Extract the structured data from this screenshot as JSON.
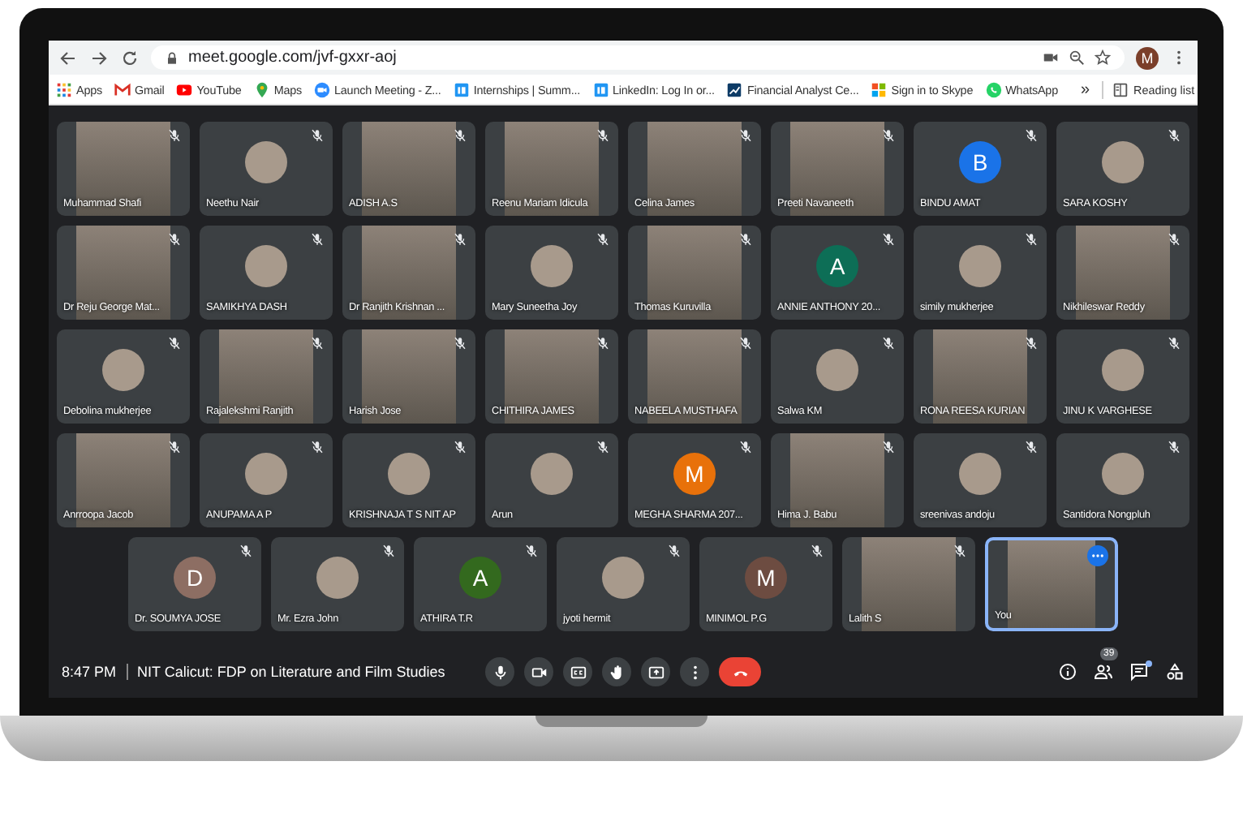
{
  "browser": {
    "url": "meet.google.com/jvf-gxxr-aoj",
    "profile_letter": "M",
    "bookmarks": [
      {
        "label": "Apps",
        "kind": "grid"
      },
      {
        "label": "Gmail",
        "kind": "mail"
      },
      {
        "label": "YouTube",
        "kind": "play"
      },
      {
        "label": "Maps",
        "kind": "pin"
      },
      {
        "label": "Launch Meeting - Z...",
        "kind": "camera"
      },
      {
        "label": "Internships | Summ...",
        "kind": "square"
      },
      {
        "label": "LinkedIn: Log In or...",
        "kind": "square"
      },
      {
        "label": "Financial Analyst Ce...",
        "kind": "chart"
      },
      {
        "label": "Sign in to Skype",
        "kind": "tiles"
      },
      {
        "label": "WhatsApp",
        "kind": "chat"
      }
    ],
    "more": "»",
    "reading_list": "Reading list"
  },
  "tiles": [
    {
      "name": "Muhammad Shafi",
      "kind": "video",
      "muted": true,
      "selected": false
    },
    {
      "name": "Neethu Nair",
      "kind": "photo",
      "muted": true,
      "selected": false
    },
    {
      "name": "ADISH A.S",
      "kind": "video",
      "muted": true,
      "selected": false
    },
    {
      "name": "Reenu Mariam Idicula",
      "kind": "video",
      "muted": true,
      "selected": false
    },
    {
      "name": "Celina James",
      "kind": "video",
      "muted": true,
      "selected": false
    },
    {
      "name": "Preeti Navaneeth",
      "kind": "video",
      "muted": true,
      "selected": false
    },
    {
      "name": "BINDU AMAT",
      "kind": "letter",
      "letter": "B",
      "color": "#1a73e8",
      "muted": true,
      "selected": false
    },
    {
      "name": "SARA KOSHY",
      "kind": "photo",
      "muted": true,
      "selected": false
    },
    {
      "name": "Dr Reju George Mat...",
      "kind": "video",
      "muted": true,
      "selected": false
    },
    {
      "name": "SAMIKHYA DASH",
      "kind": "photo",
      "muted": true,
      "selected": false
    },
    {
      "name": "Dr Ranjith Krishnan ...",
      "kind": "video",
      "muted": true,
      "selected": false
    },
    {
      "name": "Mary Suneetha Joy",
      "kind": "photo",
      "muted": true,
      "selected": false
    },
    {
      "name": "Thomas Kuruvilla",
      "kind": "video",
      "muted": true,
      "selected": false
    },
    {
      "name": "ANNIE ANTHONY 20...",
      "kind": "letter",
      "letter": "A",
      "color": "#0d6e56",
      "muted": true,
      "selected": false
    },
    {
      "name": "simily mukherjee",
      "kind": "photo",
      "muted": true,
      "selected": false
    },
    {
      "name": "Nikhileswar Reddy",
      "kind": "video",
      "muted": true,
      "selected": false
    },
    {
      "name": "Debolina mukherjee",
      "kind": "photo",
      "muted": true,
      "selected": false
    },
    {
      "name": "Rajalekshmi Ranjith",
      "kind": "video",
      "muted": true,
      "selected": false
    },
    {
      "name": "Harish Jose",
      "kind": "video",
      "muted": true,
      "selected": false
    },
    {
      "name": "CHITHIRA JAMES",
      "kind": "video",
      "muted": true,
      "selected": false
    },
    {
      "name": "NABEELA MUSTHAFA",
      "kind": "video",
      "muted": true,
      "selected": false
    },
    {
      "name": "Salwa KM",
      "kind": "photo",
      "muted": true,
      "selected": false
    },
    {
      "name": "RONA REESA KURIAN",
      "kind": "video",
      "muted": true,
      "selected": false
    },
    {
      "name": "JINU K VARGHESE",
      "kind": "photo",
      "muted": true,
      "selected": false
    },
    {
      "name": "Anrroopa Jacob",
      "kind": "video",
      "muted": true,
      "selected": false
    },
    {
      "name": "ANUPAMA A P",
      "kind": "photo",
      "muted": true,
      "selected": false
    },
    {
      "name": "KRISHNAJA T S NIT AP",
      "kind": "photo",
      "muted": true,
      "selected": false
    },
    {
      "name": "Arun",
      "kind": "photo",
      "muted": true,
      "selected": false
    },
    {
      "name": "MEGHA SHARMA 207...",
      "kind": "letter",
      "letter": "M",
      "color": "#e8710a",
      "muted": true,
      "selected": false
    },
    {
      "name": "Hima J. Babu",
      "kind": "video",
      "muted": true,
      "selected": false
    },
    {
      "name": "sreenivas andoju",
      "kind": "photo",
      "muted": true,
      "selected": false
    },
    {
      "name": "Santidora Nongpluh",
      "kind": "photo",
      "muted": true,
      "selected": false
    },
    {
      "name": "Dr. SOUMYA JOSE",
      "kind": "letter",
      "letter": "D",
      "color": "#8d6e63",
      "muted": true,
      "selected": false
    },
    {
      "name": "Mr. Ezra John",
      "kind": "photo",
      "muted": true,
      "selected": false
    },
    {
      "name": "ATHIRA T.R",
      "kind": "letter",
      "letter": "A",
      "color": "#33691e",
      "muted": true,
      "selected": false
    },
    {
      "name": "jyoti hermit",
      "kind": "photo",
      "muted": true,
      "selected": false
    },
    {
      "name": "MINIMOL P.G",
      "kind": "letter",
      "letter": "M",
      "color": "#6d4c41",
      "muted": true,
      "selected": false
    },
    {
      "name": "Lalith S",
      "kind": "video",
      "muted": true,
      "selected": false
    },
    {
      "name": "You",
      "kind": "video",
      "muted": false,
      "selected": true
    }
  ],
  "meeting": {
    "time": "8:47 PM",
    "title": "NIT Calicut: FDP on Literature and Film Studies",
    "controls": [
      {
        "kind": "mic"
      },
      {
        "kind": "camera"
      },
      {
        "kind": "captions"
      },
      {
        "kind": "hand"
      },
      {
        "kind": "present"
      },
      {
        "kind": "more"
      },
      {
        "kind": "end"
      }
    ],
    "side": [
      {
        "kind": "info"
      },
      {
        "kind": "people",
        "badge": "39"
      },
      {
        "kind": "chat"
      },
      {
        "kind": "activities"
      }
    ]
  }
}
